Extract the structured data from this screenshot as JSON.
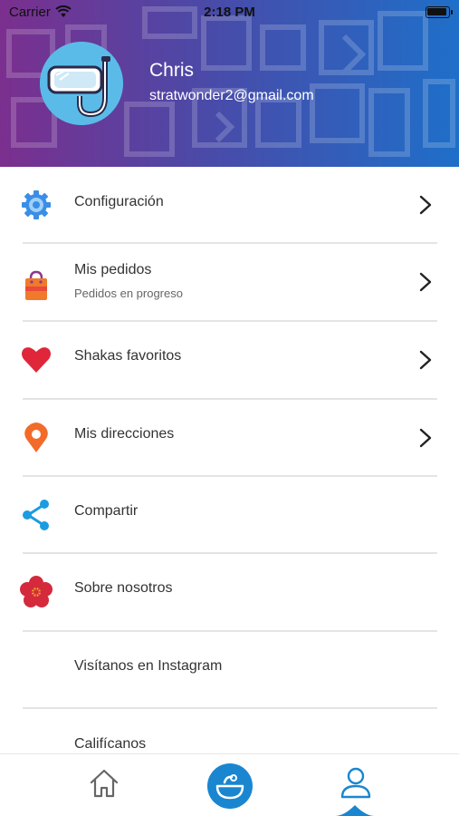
{
  "status_bar": {
    "carrier": "Carrier",
    "time": "2:18 PM"
  },
  "profile": {
    "name": "Chris",
    "email": "stratwonder2@gmail.com"
  },
  "menu": {
    "items": [
      {
        "label": "Configuración",
        "icon": "gear-icon",
        "chevron": true
      },
      {
        "label": "Mis pedidos",
        "sublabel": "Pedidos en progreso",
        "icon": "shopping-bag-icon",
        "chevron": true
      },
      {
        "label": "Shakas favoritos",
        "icon": "heart-icon",
        "chevron": true
      },
      {
        "label": "Mis direcciones",
        "icon": "map-pin-icon",
        "chevron": true
      },
      {
        "label": "Compartir",
        "icon": "share-icon",
        "chevron": false
      },
      {
        "label": "Sobre nosotros",
        "icon": "flower-icon",
        "chevron": false
      },
      {
        "label": "Visítanos en Instagram",
        "icon": "",
        "chevron": false
      },
      {
        "label": "Califícanos",
        "icon": "",
        "chevron": false
      }
    ]
  },
  "tab_bar": {
    "tabs": [
      {
        "name": "home",
        "icon": "home-icon",
        "active": false
      },
      {
        "name": "menu",
        "icon": "bowl-icon",
        "active": false
      },
      {
        "name": "profile",
        "icon": "user-icon",
        "active": true
      }
    ]
  },
  "colors": {
    "header_gradient_start": "#7b2f8e",
    "header_gradient_end": "#1e6fc9",
    "accent_blue": "#1a86d0",
    "divider": "#e4e4e4"
  }
}
